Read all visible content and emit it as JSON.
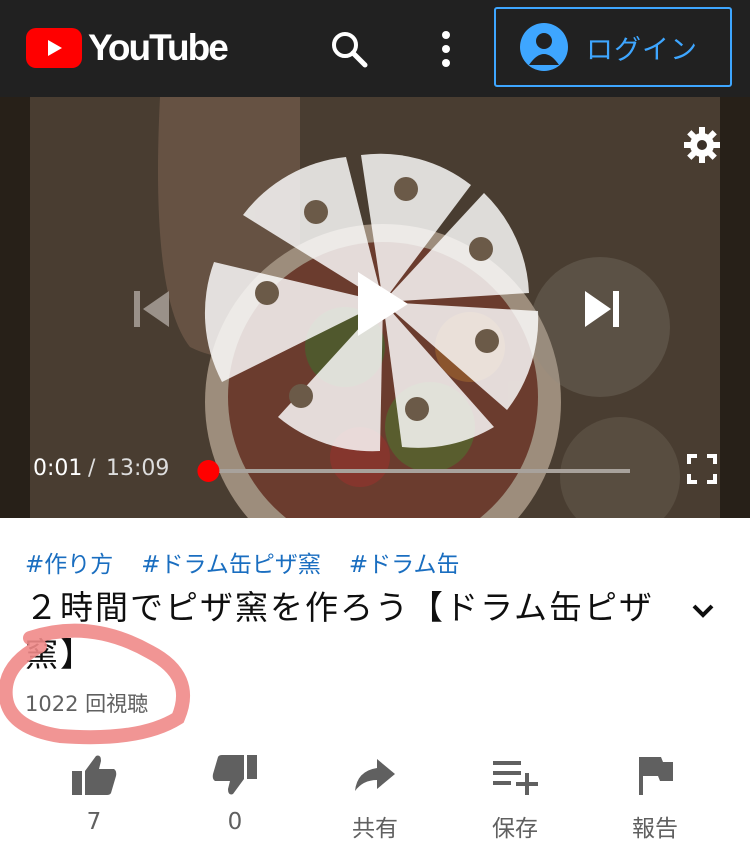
{
  "header": {
    "logo_text": "YouTube",
    "login_label": "ログイン",
    "accent_color": "#3ea6ff",
    "brand_color": "#ff0000"
  },
  "player": {
    "current_time": "0:01",
    "separator": "/",
    "duration": "13:09",
    "progress_fraction": 0.001
  },
  "video": {
    "hashtags": [
      "#作り方",
      "#ドラム缶ピザ窯",
      "#ドラム缶"
    ],
    "title": "２時間でピザ窯を作ろう【ドラム缶ピザ窯】",
    "views": "1022 回視聴"
  },
  "actions": {
    "like_count": "7",
    "dislike_count": "0",
    "share_label": "共有",
    "save_label": "保存",
    "report_label": "報告"
  }
}
